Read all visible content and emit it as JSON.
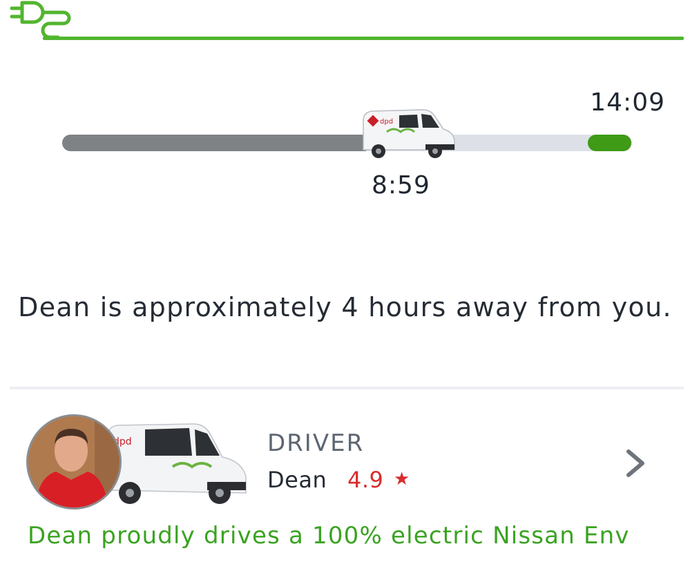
{
  "header": {
    "icon": "plug-icon",
    "accent_color": "#52b52f"
  },
  "tracking": {
    "eta_time": "14:09",
    "current_time": "8:59",
    "progress": 0.53,
    "colors": {
      "done": "#7f8285",
      "remaining": "#dde1e7",
      "destination": "#3f9a16"
    }
  },
  "message": {
    "away_text": "Dean is approximately 4 hours away from you."
  },
  "driver": {
    "caption": "DRIVER",
    "name": "Dean",
    "rating": "4.9",
    "rating_icon": "star-icon",
    "chevron_icon": "chevron-right-icon",
    "rating_color": "#d92c2c"
  },
  "eco": {
    "text": "Dean proudly drives a 100% electric Nissan Env",
    "color": "#3aa321"
  }
}
